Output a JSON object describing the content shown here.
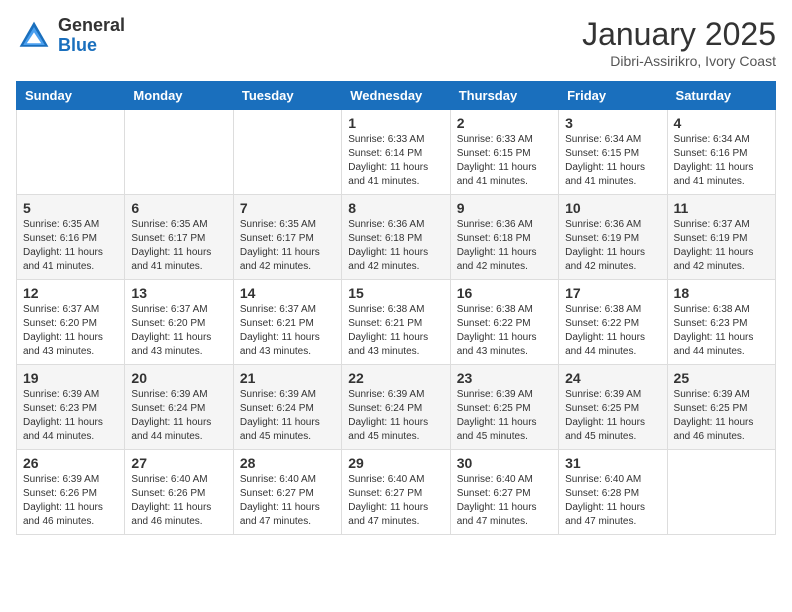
{
  "header": {
    "logo_general": "General",
    "logo_blue": "Blue",
    "month_title": "January 2025",
    "location": "Dibri-Assirikro, Ivory Coast"
  },
  "days_of_week": [
    "Sunday",
    "Monday",
    "Tuesday",
    "Wednesday",
    "Thursday",
    "Friday",
    "Saturday"
  ],
  "weeks": [
    [
      {
        "day": "",
        "info": ""
      },
      {
        "day": "",
        "info": ""
      },
      {
        "day": "",
        "info": ""
      },
      {
        "day": "1",
        "info": "Sunrise: 6:33 AM\nSunset: 6:14 PM\nDaylight: 11 hours\nand 41 minutes."
      },
      {
        "day": "2",
        "info": "Sunrise: 6:33 AM\nSunset: 6:15 PM\nDaylight: 11 hours\nand 41 minutes."
      },
      {
        "day": "3",
        "info": "Sunrise: 6:34 AM\nSunset: 6:15 PM\nDaylight: 11 hours\nand 41 minutes."
      },
      {
        "day": "4",
        "info": "Sunrise: 6:34 AM\nSunset: 6:16 PM\nDaylight: 11 hours\nand 41 minutes."
      }
    ],
    [
      {
        "day": "5",
        "info": "Sunrise: 6:35 AM\nSunset: 6:16 PM\nDaylight: 11 hours\nand 41 minutes."
      },
      {
        "day": "6",
        "info": "Sunrise: 6:35 AM\nSunset: 6:17 PM\nDaylight: 11 hours\nand 41 minutes."
      },
      {
        "day": "7",
        "info": "Sunrise: 6:35 AM\nSunset: 6:17 PM\nDaylight: 11 hours\nand 42 minutes."
      },
      {
        "day": "8",
        "info": "Sunrise: 6:36 AM\nSunset: 6:18 PM\nDaylight: 11 hours\nand 42 minutes."
      },
      {
        "day": "9",
        "info": "Sunrise: 6:36 AM\nSunset: 6:18 PM\nDaylight: 11 hours\nand 42 minutes."
      },
      {
        "day": "10",
        "info": "Sunrise: 6:36 AM\nSunset: 6:19 PM\nDaylight: 11 hours\nand 42 minutes."
      },
      {
        "day": "11",
        "info": "Sunrise: 6:37 AM\nSunset: 6:19 PM\nDaylight: 11 hours\nand 42 minutes."
      }
    ],
    [
      {
        "day": "12",
        "info": "Sunrise: 6:37 AM\nSunset: 6:20 PM\nDaylight: 11 hours\nand 43 minutes."
      },
      {
        "day": "13",
        "info": "Sunrise: 6:37 AM\nSunset: 6:20 PM\nDaylight: 11 hours\nand 43 minutes."
      },
      {
        "day": "14",
        "info": "Sunrise: 6:37 AM\nSunset: 6:21 PM\nDaylight: 11 hours\nand 43 minutes."
      },
      {
        "day": "15",
        "info": "Sunrise: 6:38 AM\nSunset: 6:21 PM\nDaylight: 11 hours\nand 43 minutes."
      },
      {
        "day": "16",
        "info": "Sunrise: 6:38 AM\nSunset: 6:22 PM\nDaylight: 11 hours\nand 43 minutes."
      },
      {
        "day": "17",
        "info": "Sunrise: 6:38 AM\nSunset: 6:22 PM\nDaylight: 11 hours\nand 44 minutes."
      },
      {
        "day": "18",
        "info": "Sunrise: 6:38 AM\nSunset: 6:23 PM\nDaylight: 11 hours\nand 44 minutes."
      }
    ],
    [
      {
        "day": "19",
        "info": "Sunrise: 6:39 AM\nSunset: 6:23 PM\nDaylight: 11 hours\nand 44 minutes."
      },
      {
        "day": "20",
        "info": "Sunrise: 6:39 AM\nSunset: 6:24 PM\nDaylight: 11 hours\nand 44 minutes."
      },
      {
        "day": "21",
        "info": "Sunrise: 6:39 AM\nSunset: 6:24 PM\nDaylight: 11 hours\nand 45 minutes."
      },
      {
        "day": "22",
        "info": "Sunrise: 6:39 AM\nSunset: 6:24 PM\nDaylight: 11 hours\nand 45 minutes."
      },
      {
        "day": "23",
        "info": "Sunrise: 6:39 AM\nSunset: 6:25 PM\nDaylight: 11 hours\nand 45 minutes."
      },
      {
        "day": "24",
        "info": "Sunrise: 6:39 AM\nSunset: 6:25 PM\nDaylight: 11 hours\nand 45 minutes."
      },
      {
        "day": "25",
        "info": "Sunrise: 6:39 AM\nSunset: 6:25 PM\nDaylight: 11 hours\nand 46 minutes."
      }
    ],
    [
      {
        "day": "26",
        "info": "Sunrise: 6:39 AM\nSunset: 6:26 PM\nDaylight: 11 hours\nand 46 minutes."
      },
      {
        "day": "27",
        "info": "Sunrise: 6:40 AM\nSunset: 6:26 PM\nDaylight: 11 hours\nand 46 minutes."
      },
      {
        "day": "28",
        "info": "Sunrise: 6:40 AM\nSunset: 6:27 PM\nDaylight: 11 hours\nand 47 minutes."
      },
      {
        "day": "29",
        "info": "Sunrise: 6:40 AM\nSunset: 6:27 PM\nDaylight: 11 hours\nand 47 minutes."
      },
      {
        "day": "30",
        "info": "Sunrise: 6:40 AM\nSunset: 6:27 PM\nDaylight: 11 hours\nand 47 minutes."
      },
      {
        "day": "31",
        "info": "Sunrise: 6:40 AM\nSunset: 6:28 PM\nDaylight: 11 hours\nand 47 minutes."
      },
      {
        "day": "",
        "info": ""
      }
    ]
  ]
}
